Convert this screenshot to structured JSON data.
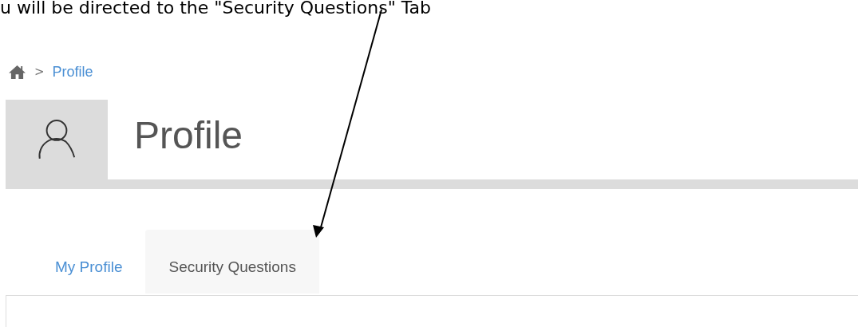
{
  "annotation": {
    "text": "u will be directed to the \"Security Questions\" Tab"
  },
  "breadcrumb": {
    "items": [
      {
        "label": "Profile"
      }
    ],
    "separator": ">"
  },
  "header": {
    "title": "Profile"
  },
  "tabs": [
    {
      "label": "My Profile",
      "selected": false
    },
    {
      "label": "Security Questions",
      "selected": true
    }
  ]
}
